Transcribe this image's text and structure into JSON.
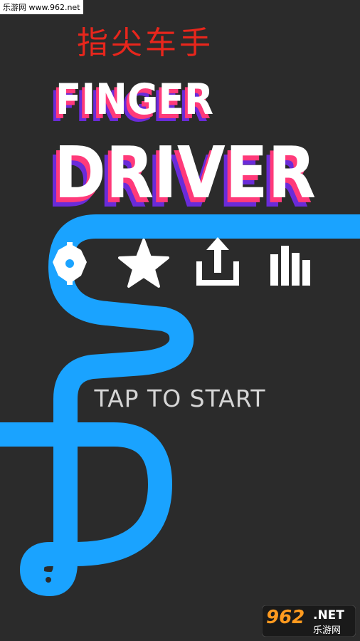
{
  "watermark": "乐游网 www.962.net",
  "chinese_title": "指尖车手",
  "logo": {
    "line1": "FINGER",
    "line2": "DRIVER"
  },
  "menu": {
    "icons": [
      "gear-icon",
      "star-icon",
      "share-icon",
      "leaderboard-icon"
    ]
  },
  "tap_to_start": "TAP TO START",
  "badge": {
    "num": "962",
    "net": ".NET",
    "sub": "乐游网"
  },
  "colors": {
    "background": "#2b2b2b",
    "road": "#1aa3ff",
    "title_red": "#e8261c",
    "logo_white": "#ffffff",
    "logo_shadow_pink": "#ff3a7a",
    "logo_shadow_purple": "#6a2bd9"
  }
}
